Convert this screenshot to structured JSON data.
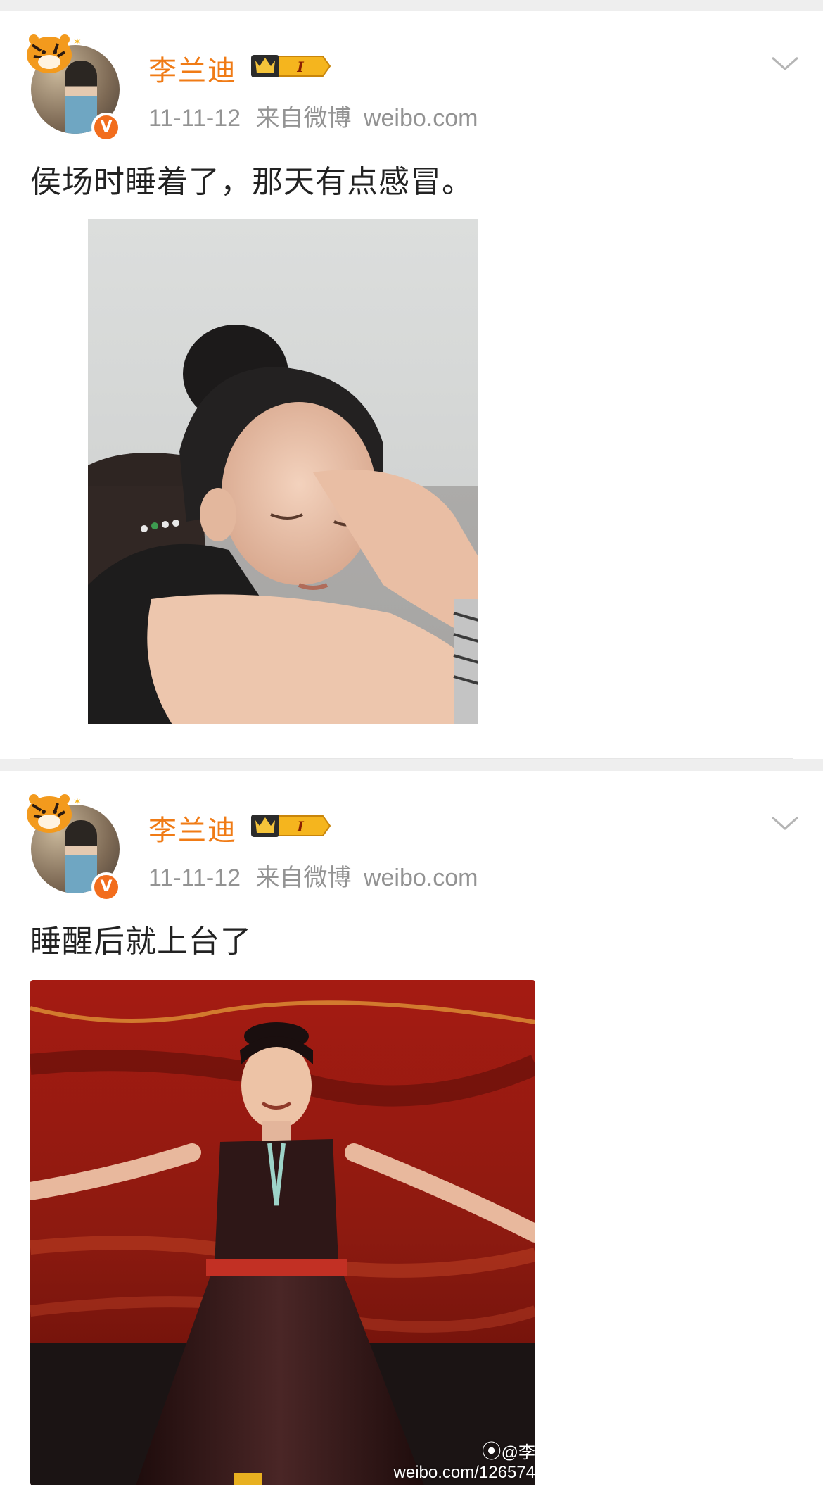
{
  "posts": [
    {
      "username": "李兰迪",
      "badge_text": "I",
      "date": "11-11-12",
      "source_prefix": "来自微博",
      "source": "weibo.com",
      "text": "侯场时睡着了，那天有点感冒。",
      "image_description": "girl-sleeping-photo"
    },
    {
      "username": "李兰迪",
      "badge_text": "I",
      "date": "11-11-12",
      "source_prefix": "来自微博",
      "source": "weibo.com",
      "text": "睡醒后就上台了",
      "image_description": "girl-dancing-on-stage-photo",
      "watermark": {
        "handle": "@李",
        "url": "weibo.com/126574"
      }
    }
  ],
  "colors": {
    "username": "#f07b15",
    "meta": "#939393",
    "verified": "#f26d1d",
    "badge_gold": "#f5b51e",
    "background": "#eeeeee"
  },
  "icons": [
    "tiger-avatar-frame-icon",
    "verified-icon",
    "vip-crown-icon",
    "chevron-down-icon",
    "weibo-logo-icon"
  ]
}
